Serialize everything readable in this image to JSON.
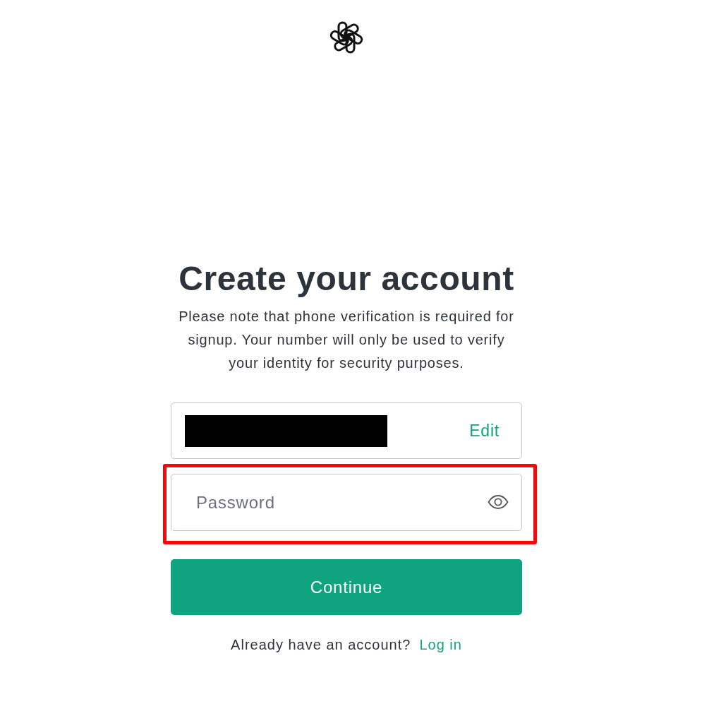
{
  "heading": "Create your account",
  "notice": "Please note that phone verification is required for signup. Your number will only be used to verify your identity for security purposes.",
  "email_field": {
    "redacted": true,
    "action": "Edit"
  },
  "password_field": {
    "placeholder": "Password",
    "highlighted": true
  },
  "primary_button": "Continue",
  "footer": {
    "prompt": "Already have an account?",
    "link": "Log in"
  }
}
